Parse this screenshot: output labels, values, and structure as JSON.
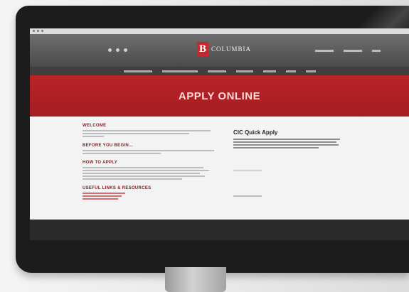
{
  "logo": {
    "mark": "B",
    "text": "COLUMBIA"
  },
  "hero": {
    "title": "APPLY ONLINE"
  },
  "sections": [
    {
      "heading": "WELCOME"
    },
    {
      "heading": "BEFORE YOU BEGIN..."
    },
    {
      "heading": "HOW TO APPLY"
    },
    {
      "heading": "USEFUL LINKS & RESOURCES"
    }
  ],
  "quick_apply": {
    "heading": "CIC Quick Apply"
  },
  "colors": {
    "brand_red": "#b82428",
    "header_gray": "#5a5a5a",
    "heading_red": "#8a1c1f"
  }
}
